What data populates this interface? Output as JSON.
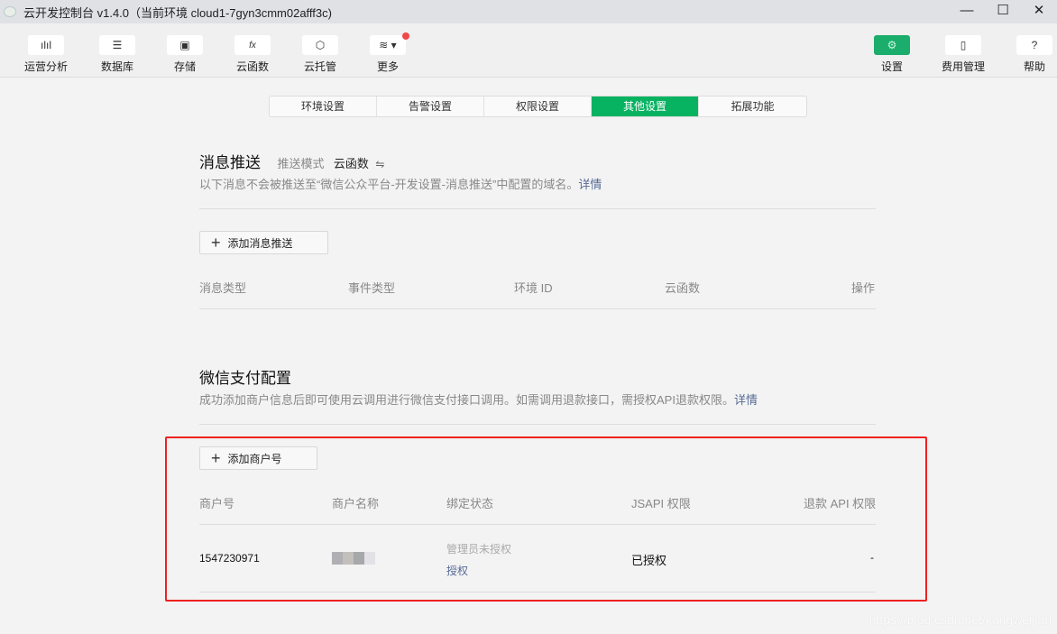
{
  "window": {
    "title": "云开发控制台 v1.4.0（当前环境 cloud1-7gyn3cmm02afff3c)",
    "minimize": "—",
    "maximize": "☐",
    "close": "✕"
  },
  "toolbar": {
    "left": [
      {
        "label": "运营分析",
        "icon": "bar-chart-icon",
        "glyph": "ılıl"
      },
      {
        "label": "数据库",
        "icon": "database-icon",
        "glyph": "☰"
      },
      {
        "label": "存储",
        "icon": "floppy-icon",
        "glyph": "▣"
      },
      {
        "label": "云函数",
        "icon": "function-icon",
        "glyph": "fx"
      },
      {
        "label": "云托管",
        "icon": "cube-icon",
        "glyph": "⬡"
      },
      {
        "label": "更多",
        "icon": "layers-icon",
        "glyph": "≋ ▾"
      }
    ],
    "right": [
      {
        "label": "设置",
        "icon": "gear-icon",
        "glyph": "⚙"
      },
      {
        "label": "费用管理",
        "icon": "billing-icon",
        "glyph": "▯"
      },
      {
        "label": "帮助",
        "icon": "help-icon",
        "glyph": "?"
      }
    ]
  },
  "tabs": [
    "环境设置",
    "告警设置",
    "权限设置",
    "其他设置",
    "拓展功能"
  ],
  "active_tab": "其他设置",
  "push": {
    "title": "消息推送",
    "mode_label": "推送模式",
    "mode_value": "云函数",
    "switch_glyph": "⇋",
    "desc": "以下消息不会被推送至“微信公众平台-开发设置-消息推送”中配置的域名。",
    "detail_link": "详情",
    "add_button": "添加消息推送",
    "columns": [
      "消息类型",
      "事件类型",
      "环境 ID",
      "云函数",
      "操作"
    ]
  },
  "pay": {
    "title": "微信支付配置",
    "desc": "成功添加商户信息后即可使用云调用进行微信支付接口调用。如需调用退款接口，需授权API退款权限。",
    "detail_link": "详情",
    "add_button": "添加商户号",
    "columns": [
      "商户号",
      "商户名称",
      "绑定状态",
      "JSAPI 权限",
      "退款 API 权限"
    ],
    "rows": [
      {
        "merchant_id": "1547230971",
        "bind_status": "管理员未授权",
        "bind_action": "授权",
        "jsapi": "已授权",
        "refund": "-"
      }
    ]
  },
  "watermark": "https://blog.csdn.net/kangweijian",
  "colors": {
    "accent": "#07b261",
    "link": "#576b95",
    "highlight": "#f02020"
  }
}
